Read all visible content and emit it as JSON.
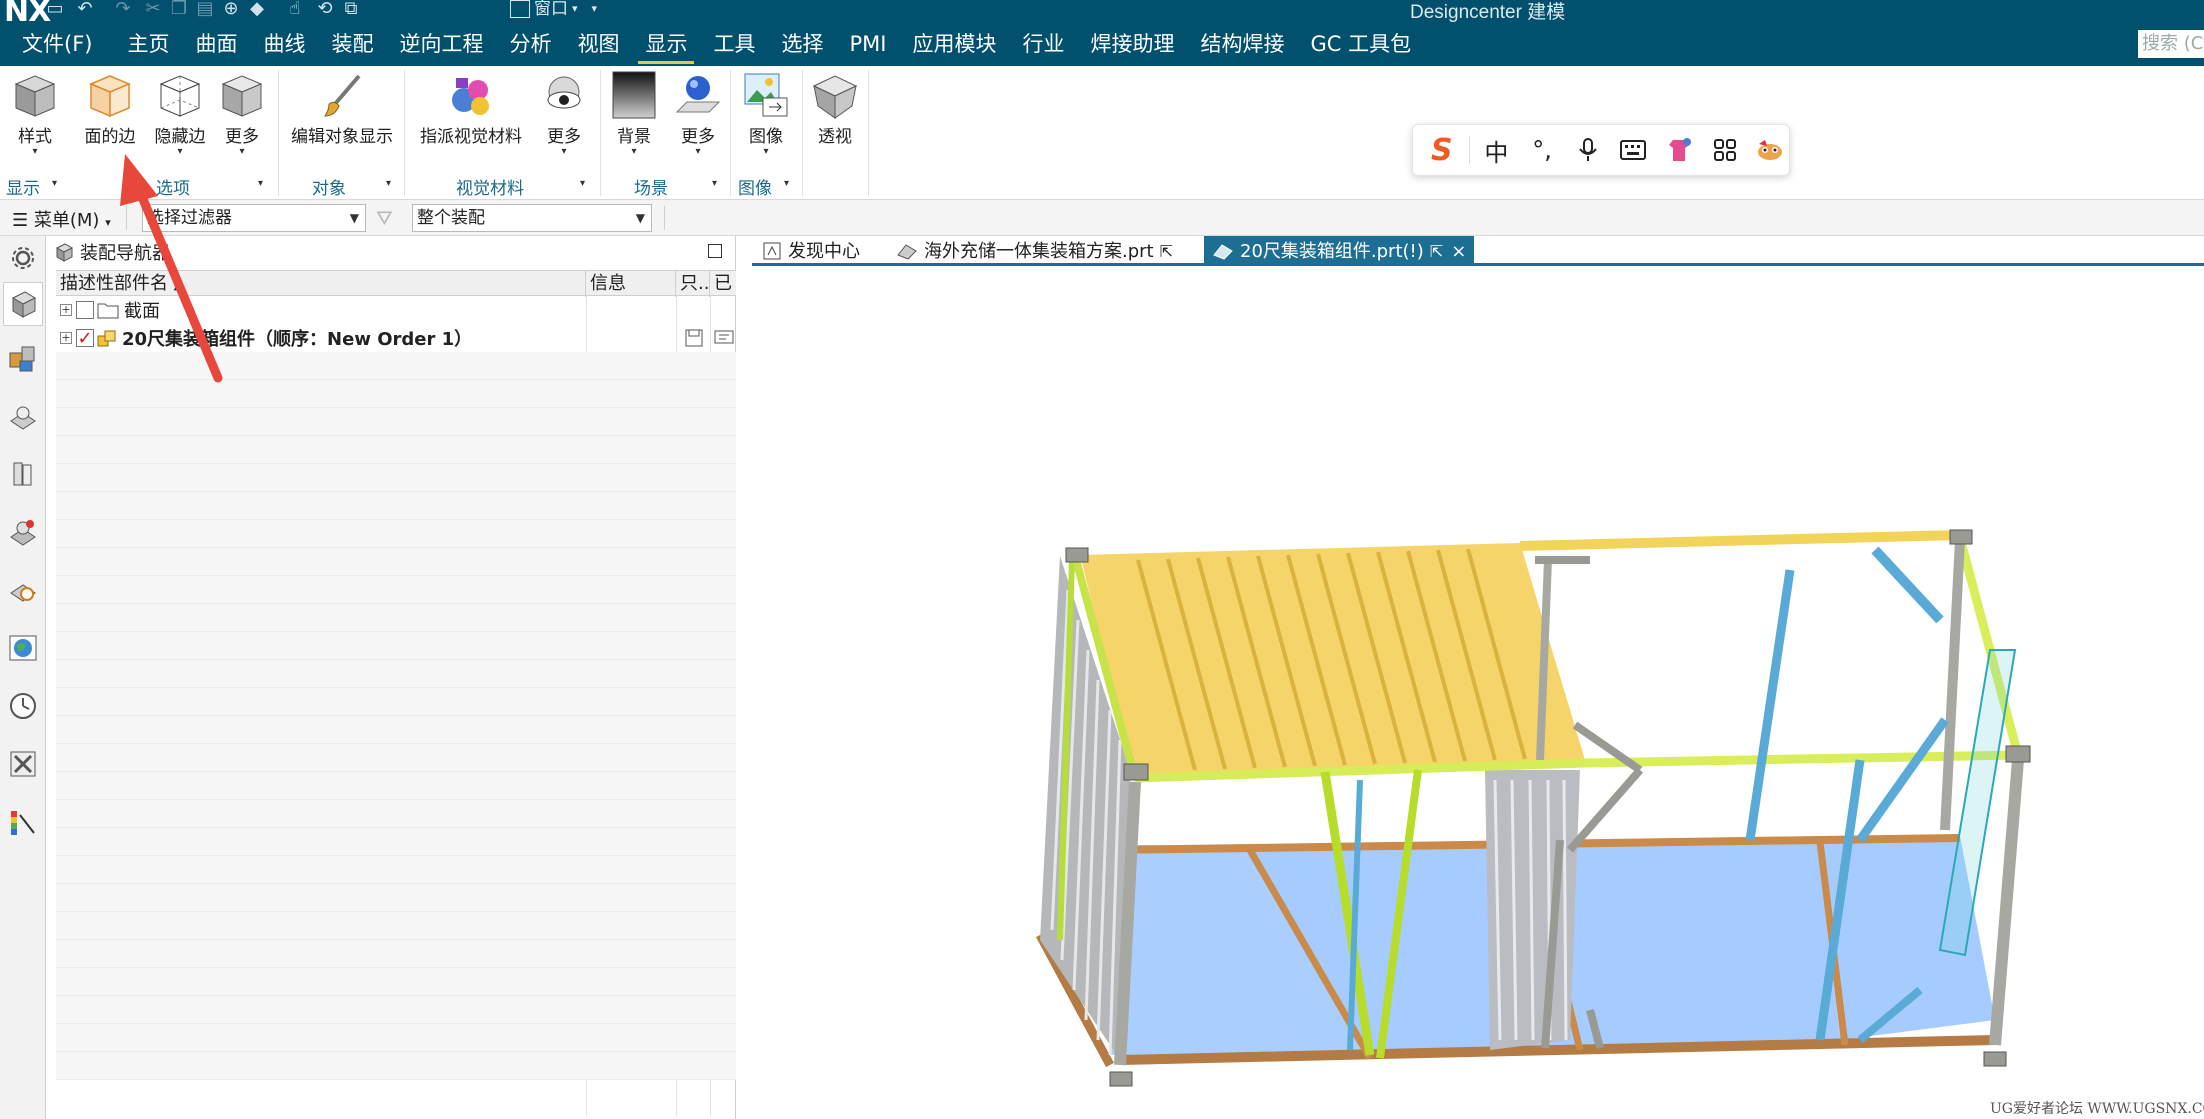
{
  "titlebar": {
    "logo": "NX",
    "window_menu": "窗口",
    "title": "Designcenter 建模"
  },
  "menubar": {
    "items": [
      "文件(F)",
      "主页",
      "曲面",
      "曲线",
      "装配",
      "逆向工程",
      "分析",
      "视图",
      "显示",
      "工具",
      "选择",
      "PMI",
      "应用模块",
      "行业",
      "焊接助理",
      "结构焊接",
      "GC 工具包"
    ],
    "active": "显示",
    "search_placeholder": "搜索 (Ctrl"
  },
  "ribbon": {
    "buttons": {
      "style": "样式",
      "face_edges": "面的边",
      "hidden_edges": "隐藏边",
      "more1": "更多",
      "edit_object_display": "编辑对象显示",
      "assign_visual_material": "指派视觉材料",
      "more2": "更多",
      "background": "背景",
      "more3": "更多",
      "image": "图像",
      "perspective": "透视"
    },
    "groups": {
      "display": "显示",
      "edges_group": "选项",
      "object": "对象",
      "visual_material": "视觉材料",
      "scene": "场景",
      "image": "图像"
    }
  },
  "ime_toolbar": {
    "logo": "S",
    "lang": "中",
    "punct": "°,"
  },
  "filterbar": {
    "menu": "菜单(M)",
    "selection_filter": "选择过滤器",
    "assembly_scope": "整个装配"
  },
  "navigator": {
    "title": "装配导航器",
    "columns": [
      "描述性部件名",
      "信息",
      "只..",
      "已"
    ],
    "nodes": [
      {
        "label": "截面",
        "checked": false
      },
      {
        "label": "20尺集装箱组件（顺序：New Order 1）",
        "checked": true
      }
    ]
  },
  "tabs": [
    {
      "label": "发现中心"
    },
    {
      "label": "海外充储一体集装箱方案.prt"
    },
    {
      "label": "20尺集装箱组件.prt(!)",
      "active": true
    }
  ],
  "watermark": "UG爱好者论坛 WWW.UGSNX.COM",
  "colors": {
    "topbar": "#00506e",
    "accent_tab": "#1c6f93",
    "annotation_arrow": "#e8473c"
  }
}
